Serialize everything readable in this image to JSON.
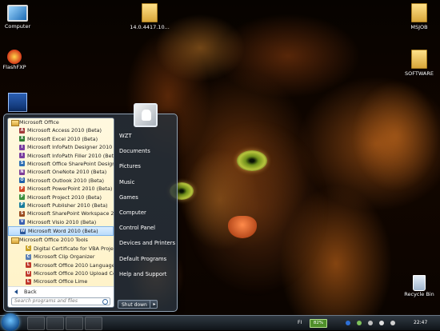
{
  "desktop": {
    "icons": [
      {
        "label": "Computer"
      },
      {
        "label": "14.0.4417.10..."
      },
      {
        "label": "MSJOB"
      },
      {
        "label": "FlashFXP"
      },
      {
        "label": "SOFTWARE"
      },
      {
        "label": ""
      },
      {
        "label": "Recycle Bin"
      }
    ]
  },
  "start_menu": {
    "programs": [
      {
        "label": "Microsoft Office",
        "kind": "folder",
        "icon": "folder-icon"
      },
      {
        "label": "Microsoft Access 2010 (Beta)",
        "kind": "app",
        "icon": "access-icon",
        "color": "#a33b3b",
        "glyph": "A"
      },
      {
        "label": "Microsoft Excel 2010 (Beta)",
        "kind": "app",
        "icon": "excel-icon",
        "color": "#2e7d32",
        "glyph": "X"
      },
      {
        "label": "Microsoft InfoPath Designer 2010 (B",
        "kind": "app",
        "icon": "infopath-icon",
        "color": "#7b3fa0",
        "glyph": "I"
      },
      {
        "label": "Microsoft InfoPath Filler 2010 (Beta)",
        "kind": "app",
        "icon": "infopath-icon",
        "color": "#7b3fa0",
        "glyph": "I"
      },
      {
        "label": "Microsoft Office SharePoint Designe",
        "kind": "app",
        "icon": "sharepoint-icon",
        "color": "#2f6fb3",
        "glyph": "S"
      },
      {
        "label": "Microsoft OneNote 2010 (Beta)",
        "kind": "app",
        "icon": "onenote-icon",
        "color": "#7d3c98",
        "glyph": "N"
      },
      {
        "label": "Microsoft Outlook 2010 (Beta)",
        "kind": "app",
        "icon": "outlook-icon",
        "color": "#1f5fa8",
        "glyph": "O"
      },
      {
        "label": "Microsoft PowerPoint 2010 (Beta)",
        "kind": "app",
        "icon": "powerpoint-icon",
        "color": "#d24726",
        "glyph": "P"
      },
      {
        "label": "Microsoft Project 2010 (Beta)",
        "kind": "app",
        "icon": "project-icon",
        "color": "#3c8f3c",
        "glyph": "P"
      },
      {
        "label": "Microsoft Publisher 2010 (Beta)",
        "kind": "app",
        "icon": "publisher-icon",
        "color": "#1a7d9c",
        "glyph": "P"
      },
      {
        "label": "Microsoft SharePoint Workspace 201",
        "kind": "app",
        "icon": "sharepoint-workspace-icon",
        "color": "#9a4b1e",
        "glyph": "S"
      },
      {
        "label": "Microsoft Visio 2010 (Beta)",
        "kind": "app",
        "icon": "visio-icon",
        "color": "#3a5fb0",
        "glyph": "V"
      },
      {
        "label": "Microsoft Word 2010 (Beta)",
        "kind": "app",
        "icon": "word-icon",
        "color": "#2b579a",
        "glyph": "W",
        "highlight": true
      },
      {
        "label": "Microsoft Office 2010 Tools",
        "kind": "folder",
        "icon": "folder-icon"
      },
      {
        "label": "Digital Certificate for VBA Projec",
        "kind": "sub",
        "icon": "certificate-icon",
        "color": "#c9a227",
        "glyph": "C"
      },
      {
        "label": "Microsoft Clip Organizer",
        "kind": "sub",
        "icon": "clip-organizer-icon",
        "color": "#5b7fb5",
        "glyph": "C"
      },
      {
        "label": "Microsoft Office 2010 Language",
        "kind": "sub",
        "icon": "language-icon",
        "color": "#c0392b",
        "glyph": "L"
      },
      {
        "label": "Microsoft Office 2010 Upload Ce",
        "kind": "sub",
        "icon": "upload-center-icon",
        "color": "#c0392b",
        "glyph": "U"
      },
      {
        "label": "Microsoft Office Lime",
        "kind": "sub",
        "icon": "lime-icon",
        "color": "#c0392b",
        "glyph": "L"
      }
    ],
    "back_label": "Back",
    "search_placeholder": "Search programs and files",
    "right_links": [
      "WZT",
      "Documents",
      "Pictures",
      "Music",
      "Games",
      "Computer",
      "Control Panel",
      "Devices and Printers",
      "Default Programs",
      "Help and Support"
    ],
    "shutdown_label": "Shut down",
    "shutdown_arrow": "▸"
  },
  "taskbar": {
    "language": "FI",
    "battery": "82%",
    "clock": "22:47"
  }
}
